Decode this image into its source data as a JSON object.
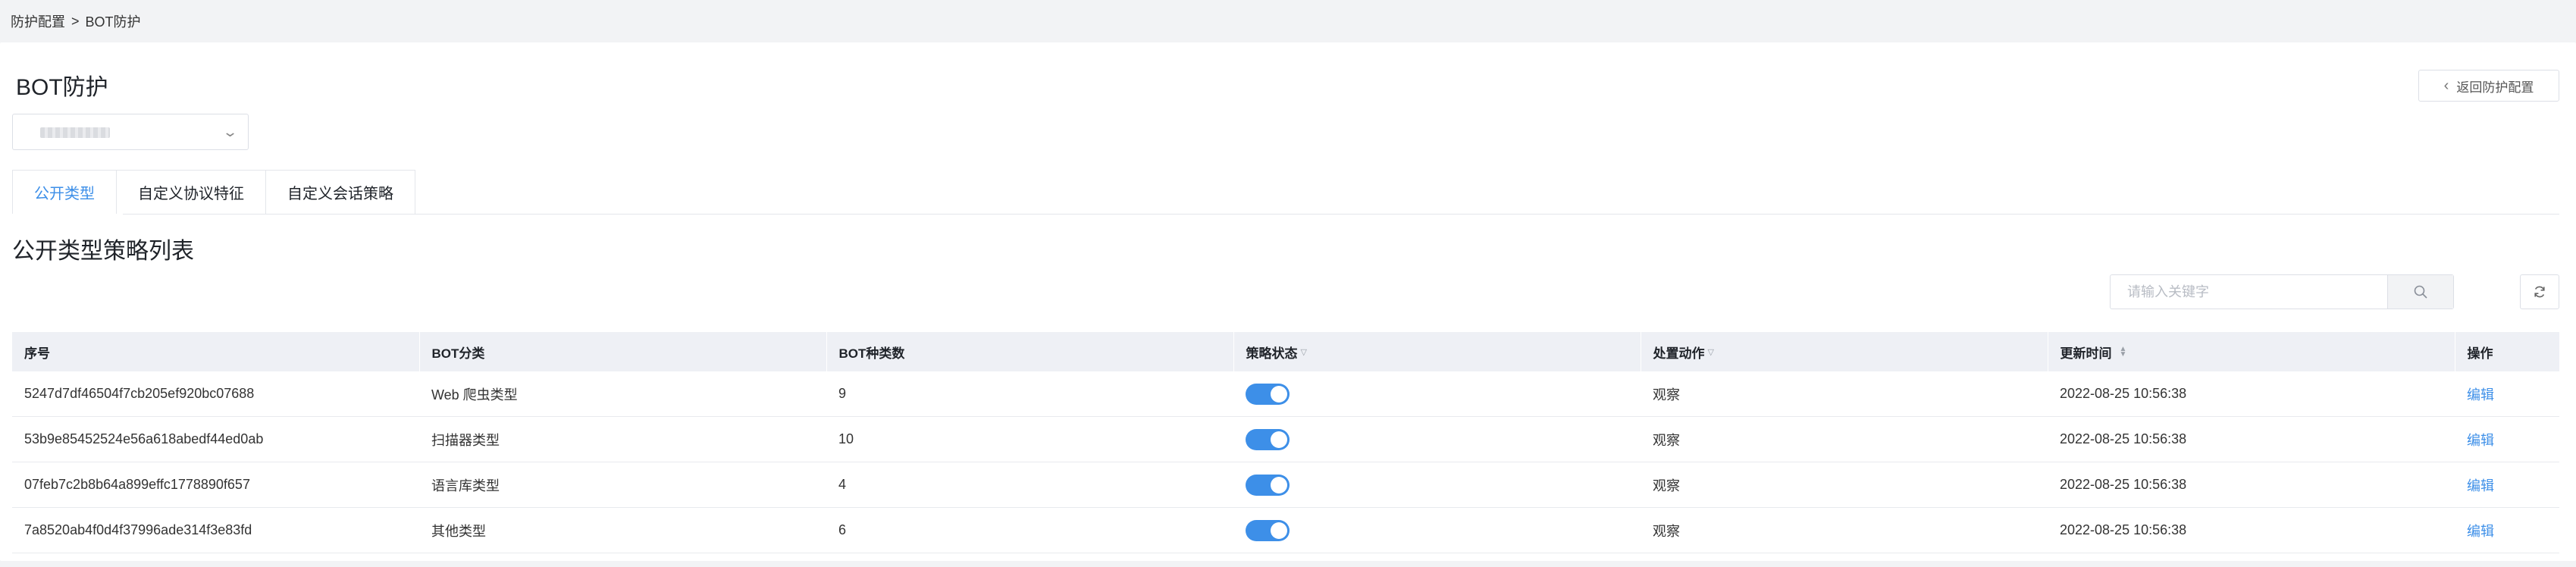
{
  "breadcrumb": {
    "parent": "防护配置",
    "separator": ">",
    "current": "BOT防护"
  },
  "page": {
    "title": "BOT防护",
    "back_label": "返回防护配置"
  },
  "tabs": [
    {
      "label": "公开类型",
      "active": true
    },
    {
      "label": "自定义协议特征",
      "active": false
    },
    {
      "label": "自定义会话策略",
      "active": false
    }
  ],
  "section": {
    "title": "公开类型策略列表"
  },
  "search": {
    "placeholder": "请输入关键字",
    "value": ""
  },
  "table": {
    "columns": [
      "序号",
      "BOT分类",
      "BOT种类数",
      "策略状态",
      "处置动作",
      "更新时间",
      "操作"
    ],
    "rows": [
      {
        "id": "5247d7df46504f7cb205ef920bc07688",
        "category": "Web 爬虫类型",
        "count": "9",
        "enabled": true,
        "action": "观察",
        "updated": "2022-08-25 10:56:38",
        "op": "编辑"
      },
      {
        "id": "53b9e85452524e56a618abedf44ed0ab",
        "category": "扫描器类型",
        "count": "10",
        "enabled": true,
        "action": "观察",
        "updated": "2022-08-25 10:56:38",
        "op": "编辑"
      },
      {
        "id": "07feb7c2b8b64a899effc1778890f657",
        "category": "语言库类型",
        "count": "4",
        "enabled": true,
        "action": "观察",
        "updated": "2022-08-25 10:56:38",
        "op": "编辑"
      },
      {
        "id": "7a8520ab4f0d4f37996ade314f3e83fd",
        "category": "其他类型",
        "count": "6",
        "enabled": true,
        "action": "观察",
        "updated": "2022-08-25 10:56:38",
        "op": "编辑"
      }
    ]
  },
  "colors": {
    "accent": "#3d8fe8",
    "header_bg": "#eef0f5",
    "page_bg": "#f2f3f5"
  }
}
